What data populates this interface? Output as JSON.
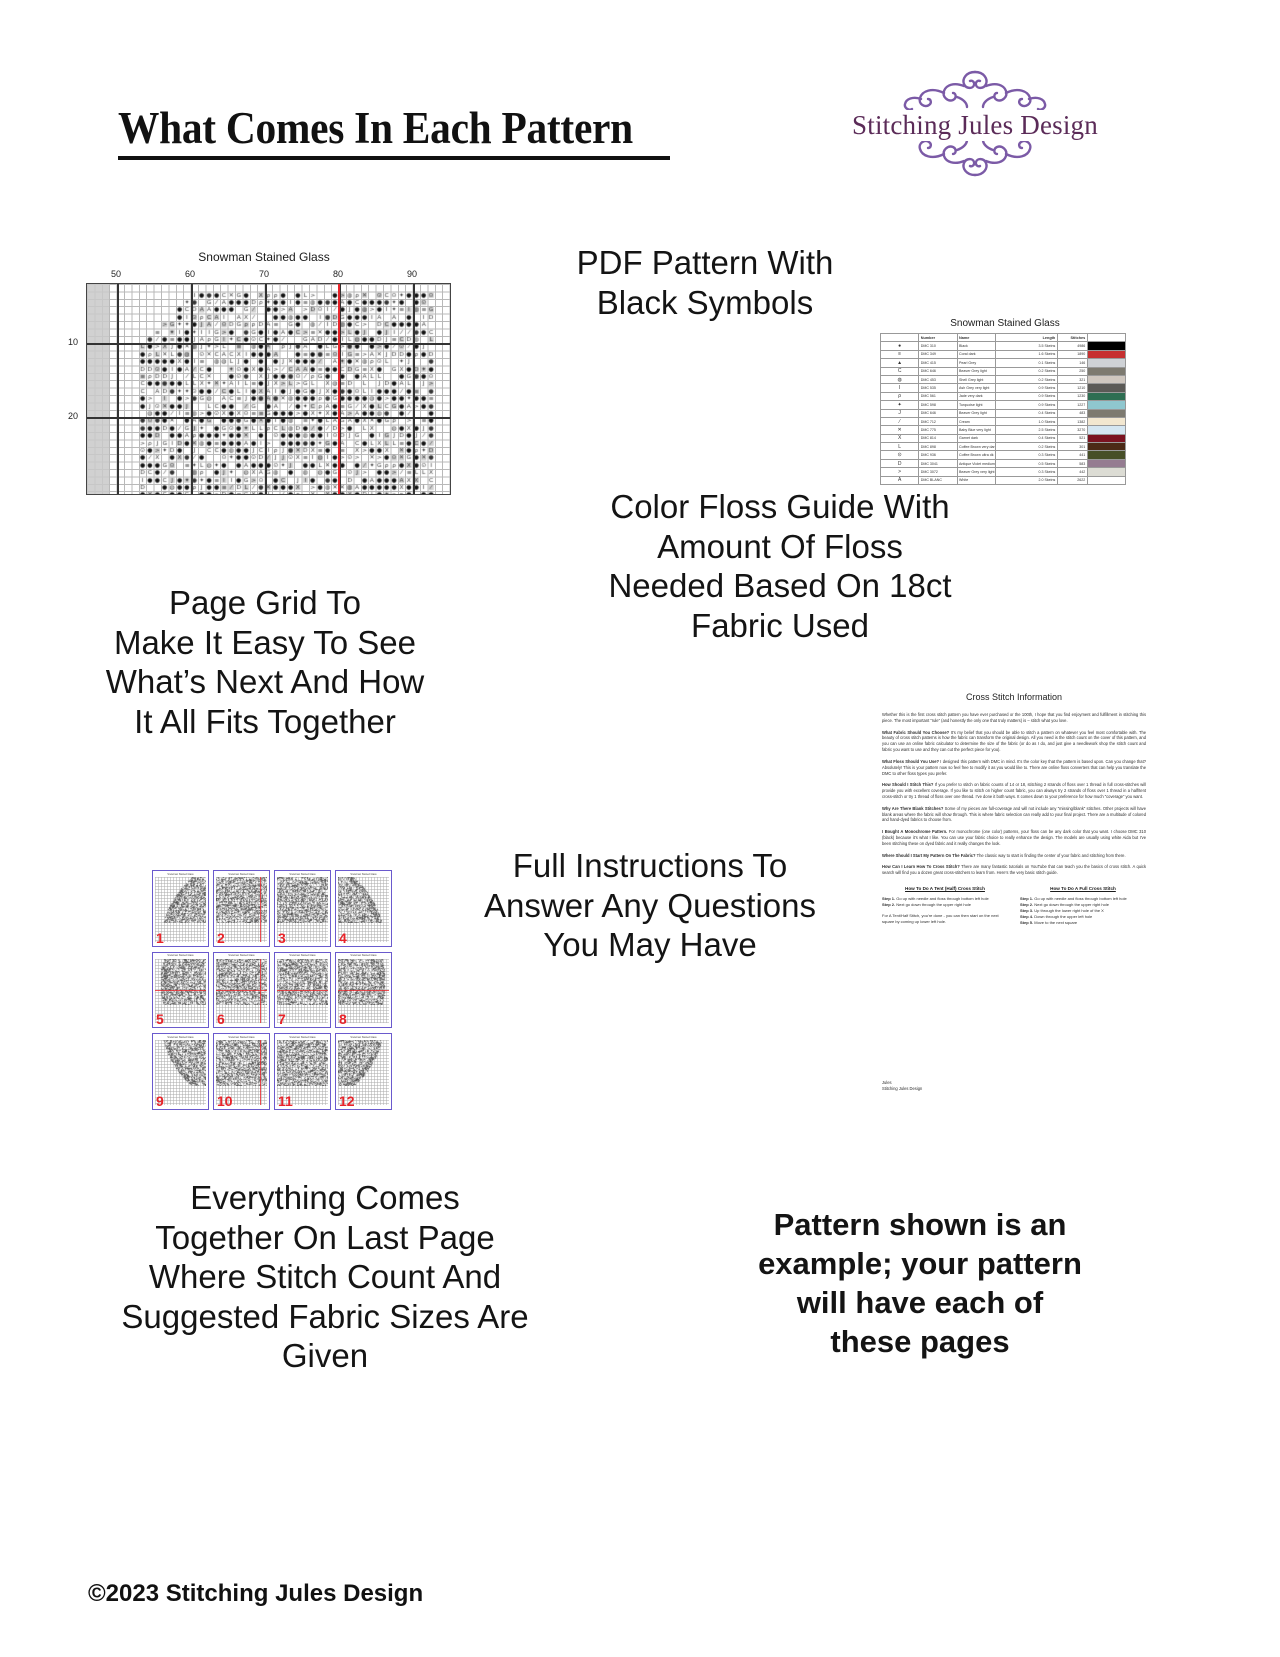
{
  "header": {
    "title": "What Comes In Each Pattern",
    "logo": {
      "brand": "Stitching Jules Design",
      "flourish_top": "❧❧❧",
      "flourish_bottom": "❧❧❧",
      "text_color": "#5b2b58",
      "flourish_color": "#7b5aa6"
    }
  },
  "copy": {
    "pdf_pattern": "PDF Pattern With\nBlack Symbols",
    "floss_guide": "Color Floss Guide With\nAmount Of Floss\nNeeded Based On 18ct\nFabric Used",
    "page_grid": "Page Grid To\nMake It Easy To See\nWhat’s Next And How\nIt All Fits Together",
    "instructions": "Full Instructions To\nAnswer Any Questions\nYou May Have",
    "last_page": "Everything Comes\nTogether On Last Page\nWhere Stitch Count And\nSuggested Fabric Sizes Are\nGiven",
    "example_note": "Pattern shown is an\nexample; your pattern\nwill have each of\nthese pages"
  },
  "copyright": "©2023 Stitching Jules Design",
  "chart_thumbnail": {
    "title": "Snowman Stained Glass",
    "column_labels": [
      "50",
      "60",
      "70",
      "80",
      "90"
    ],
    "row_labels": [
      "10",
      "20"
    ],
    "center_line_color": "#e8242a"
  },
  "floss_table": {
    "title": "Snowman Stained Glass",
    "columns": [
      "",
      "Number",
      "Name",
      "Length",
      "Stitches"
    ],
    "rows": [
      {
        "symbol": "●",
        "number": "DMC   310",
        "name": "Black",
        "length": "3.5 Skeins",
        "stitches": "4986",
        "color": "#000000"
      },
      {
        "symbol": "≡",
        "number": "DMC   349",
        "name": "Coral dark",
        "length": "1.6 Skeins",
        "stitches": "1890",
        "color": "#c63030"
      },
      {
        "symbol": "▲",
        "number": "DMC   415",
        "name": "Pearl Grey",
        "length": "0.1 Skeins",
        "stitches": "146",
        "color": "#cfd2d6"
      },
      {
        "symbol": "C",
        "number": "DMC   646",
        "name": "Beaver Grey light",
        "length": "0.2 Skeins",
        "stitches": "250",
        "color": "#7d7a70"
      },
      {
        "symbol": "◍",
        "number": "DMC   453",
        "name": "Shell Grey light",
        "length": "0.2 Skeins",
        "stitches": "321",
        "color": "#cfc7bf"
      },
      {
        "symbol": "I",
        "number": "DMC   535",
        "name": "Ash Grey very light",
        "length": "0.9 Skeins",
        "stitches": "1210",
        "color": "#5b5a56"
      },
      {
        "symbol": "ρ",
        "number": "DMC   561",
        "name": "Jade very dark",
        "length": "0.9 Skeins",
        "stitches": "1230",
        "color": "#2e6e52"
      },
      {
        "symbol": "✦",
        "number": "DMC   598",
        "name": "Turquoise light",
        "length": "0.9 Skeins",
        "stitches": "1227",
        "color": "#8fc7cf"
      },
      {
        "symbol": "J",
        "number": "DMC   646",
        "name": "Beaver Grey light",
        "length": "0.4 Skeins",
        "stitches": "483",
        "color": "#7d7a70"
      },
      {
        "symbol": "⁄",
        "number": "DMC   712",
        "name": "Cream",
        "length": "1.0 Skeins",
        "stitches": "1382",
        "color": "#f2e7d0"
      },
      {
        "symbol": "✕",
        "number": "DMC   775",
        "name": "Baby Blue very light",
        "length": "2.5 Skeins",
        "stitches": "3270",
        "color": "#d4e6f2"
      },
      {
        "symbol": "X",
        "number": "DMC   814",
        "name": "Garnet dark",
        "length": "0.4 Skeins",
        "stitches": "521",
        "color": "#7a1220"
      },
      {
        "symbol": "L",
        "number": "DMC   898",
        "name": "Coffee Brown very dark",
        "length": "0.2 Skeins",
        "stitches": "301",
        "color": "#4b2a16"
      },
      {
        "symbol": "⊙",
        "number": "DMC   936",
        "name": "Coffee Brown ultra dk",
        "length": "0.3 Skeins",
        "stitches": "441",
        "color": "#474f27"
      },
      {
        "symbol": "D",
        "number": "DMC   3041",
        "name": "Antique Violet medium",
        "length": "0.5 Skeins",
        "stitches": "583",
        "color": "#957c91"
      },
      {
        "symbol": ">",
        "number": "DMC   3072",
        "name": "Beaver Grey very light",
        "length": "0.3 Skeins",
        "stitches": "442",
        "color": "#dcdcd4"
      },
      {
        "symbol": "A",
        "number": "DMC   BLANC",
        "name": "White",
        "length": "2.0 Skeins",
        "stitches": "2622",
        "color": "#ffffff"
      }
    ]
  },
  "page_grid_thumbnails": {
    "numbers": [
      "1",
      "2",
      "3",
      "4",
      "5",
      "6",
      "7",
      "8",
      "9",
      "10",
      "11",
      "12"
    ],
    "sheet_title": "Snowman Stained Glass",
    "border_color": "#6a5acd",
    "number_color": "#e8242a"
  },
  "instructions_page": {
    "title": "Cross Stitch Information",
    "paragraphs": [
      {
        "lead": "",
        "text": "Whether this is the first cross stitch pattern you have ever purchased or the 100th, I hope that you find enjoyment and fulfillment in stitching this piece. The most important “rule” (and honestly the only one that truly matters) is – stitch what you love."
      },
      {
        "lead": "What Fabric Should You Choose?",
        "text": " It’s my belief that you should be able to stitch a pattern on whatever you feel most comfortable with. The beauty of cross stitch patterns is how the fabric can transform the original design. All you need is the stitch count on the cover of this pattern, and you can use an online fabric calculator to determine the size of the fabric (or do as I do, and just give a needlework shop the stitch count and fabric you want to use and they can cut the perfect piece for you)."
      },
      {
        "lead": "What Floss Should You Use?",
        "text": " I designed this pattern with DMC in mind. It’s the color key that the pattern is based upon. Can you change that? Absolutely! This is your pattern now so feel free to modify it as you would like to. There are online floss converters that can help you translate the DMC to other floss types you prefer."
      },
      {
        "lead": "How Should I Stitch This?",
        "text": " If you prefer to stitch on fabric counts of 14 or 18, stitching 2 strands of floss over 1 thread in full cross-stitches will provide you with excellent coverage. If you like to stitch on higher count fabric, you can always try 2 strands of floss over 1 thread in a half/tent cross-stitch or try 1 thread of floss over one thread. I’ve done it both ways. It comes down to your preference for how much “coverage” you want."
      },
      {
        "lead": "Why Are There Blank Stitches?",
        "text": " Some of my pieces are full-coverage and will not include any “missing/blank” stitches. Other projects will have blank areas where the fabric will show through. This is where fabric selection can really add to your final project. There are a multitude of colored and hand-dyed fabrics to choose from."
      },
      {
        "lead": "I Bought A Monochrome Pattern.",
        "text": " For monochrome (one color) patterns, your floss can be any dark color that you want. I choose DMC 310 (black) because it’s what I like. You can use your fabric choice to really enhance the design. The models are usually using white Aida but I’ve been stitching these on dyed fabric and it really changes the look."
      },
      {
        "lead": "Where Should I Start My Pattern On The Fabric?",
        "text": " The classic way to start is finding the center of your fabric and stitching from there."
      },
      {
        "lead": "How Can I Learn How To Cross Stitch?",
        "text": " There are many fantastic tutorials on YouTube that can teach you the basics of cross stitch. A quick search will find you a dozen great cross-stitchers to learn from. Here’s the very basic stitch guide."
      }
    ],
    "guides": [
      {
        "heading": "How To Do A Tent (Half) Cross Stitch",
        "steps": [
          "Step 1. Go up with needle and floss through bottom left hole",
          "Step 2. Next go down through the upper right hole"
        ],
        "note": "For A Tent/Half Stitch, you’re done - you can then start on the next square by coming up lower left hole."
      },
      {
        "heading": "How To Do A Full Cross Stitch",
        "steps": [
          "Step 1. Go up with needle and floss through bottom left hole",
          "Step 2. Next go down through the upper right hole",
          "Step 3. Up through the lower right hole of the X",
          "Step 4. Down through the upper left hole",
          "Step 5. Move to the next square"
        ],
        "note": ""
      }
    ],
    "signature": "Jules\nStitching Jules Design"
  }
}
